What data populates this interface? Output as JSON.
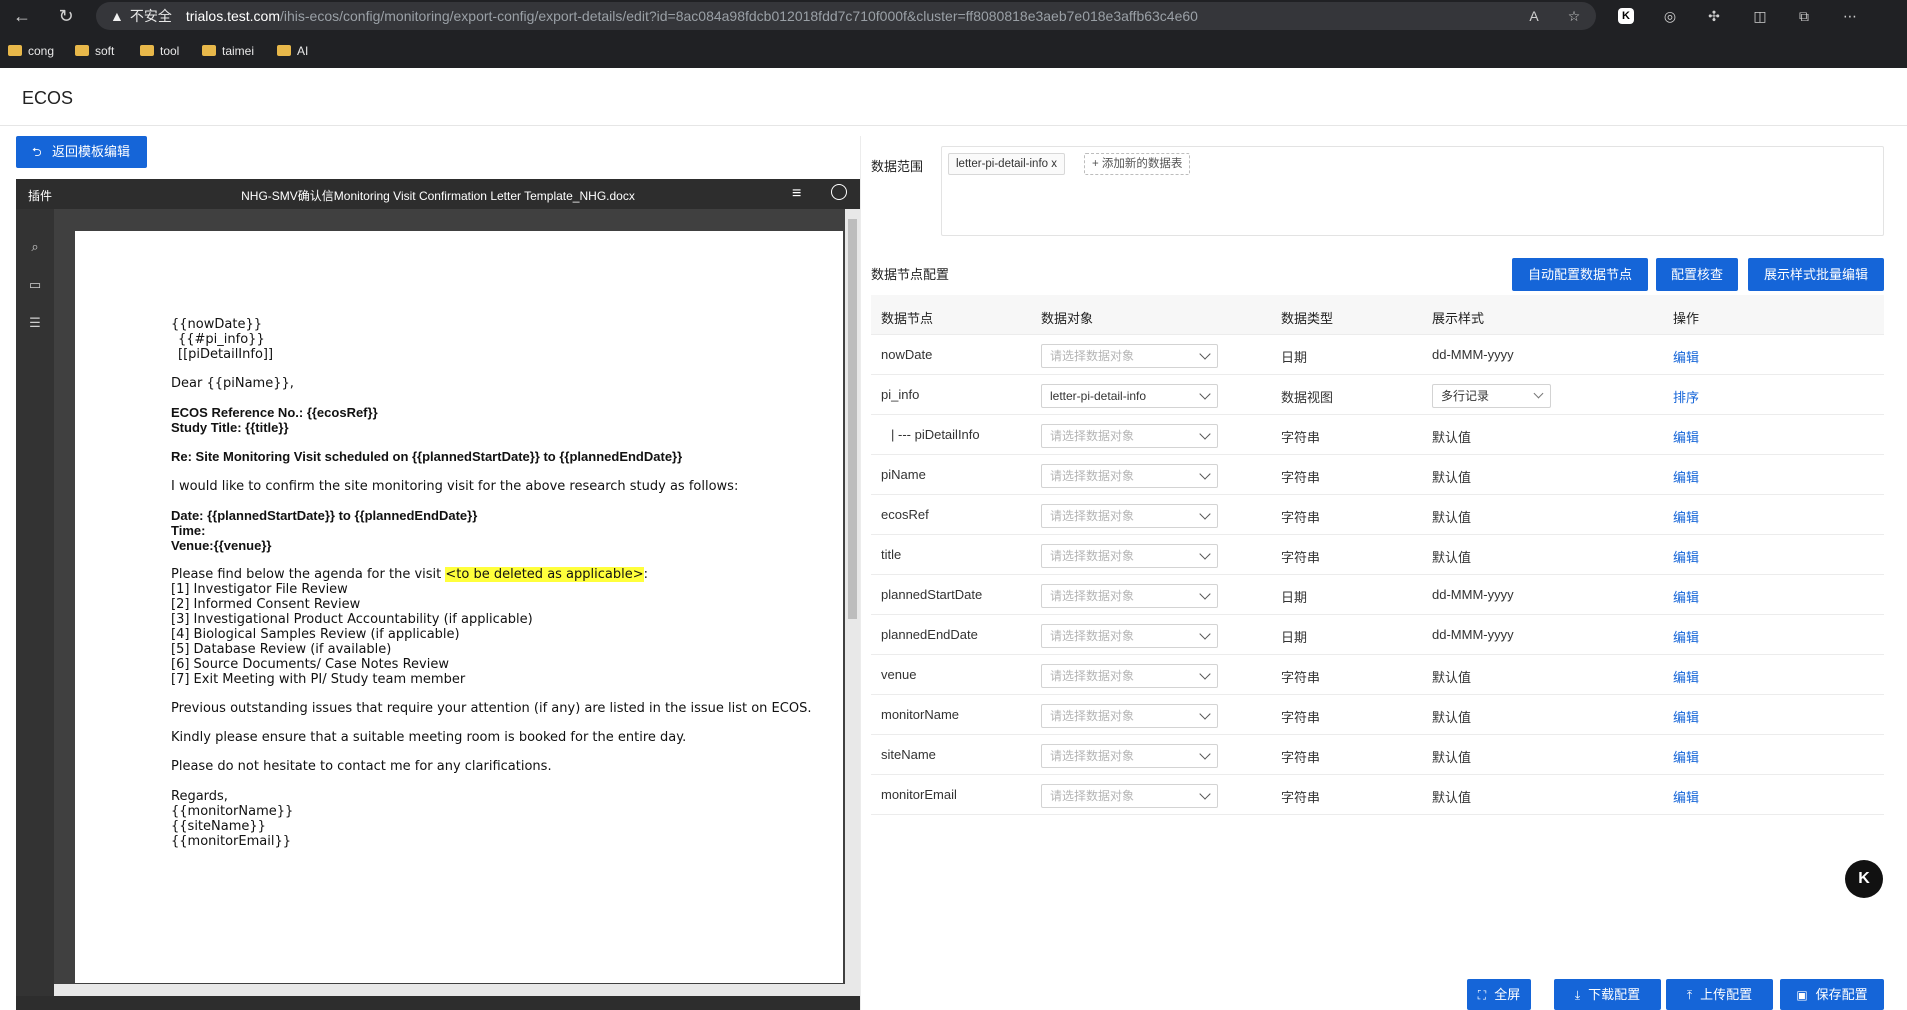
{
  "browser": {
    "security_warning": "不安全",
    "url_host": "trialos.test.com",
    "url_path": "/ihis-ecos/config/monitoring/export-config/export-details/edit?id=8ac084a98fdcb012018fdd7c710f000f&cluster=ff8080818e3aeb7e018e3affb63c4e60",
    "bookmarks": [
      "cong",
      "soft",
      "tool",
      "taimei",
      "AI"
    ]
  },
  "app": {
    "title": "ECOS"
  },
  "left": {
    "back_label": "返回模板编辑",
    "doc_toolbar": {
      "plugin_label": "插件",
      "file_name": "NHG-SMV确认信Monitoring Visit Confirmation Letter Template_NHG.docx"
    },
    "doc_lines": [
      "{{nowDate}}",
      "{{#pi_info}}",
      "[[piDetailInfo]]",
      "Dear {{piName}},",
      "ECOS Reference No.: {{ecosRef}}",
      "Study Title: {{title}}",
      "Re: Site Monitoring Visit scheduled on {{plannedStartDate}} to {{plannedEndDate}}",
      "I would like to confirm the site monitoring visit for the above research study as follows:",
      "Date: {{plannedStartDate}} to {{plannedEndDate}}",
      "Time:",
      "Venue:{{venue}}",
      "Please find below the agenda for the visit ",
      "<to be deleted as applicable>",
      ":",
      "[1] Investigator File Review",
      "[2] Informed Consent Review",
      "[3] Investigational Product Accountability (if applicable)",
      "[4] Biological Samples Review (if applicable)",
      "[5] Database Review (if available)",
      "[6] Source Documents/ Case Notes Review",
      "[7] Exit Meeting with PI/ Study team member",
      "Previous outstanding issues that require your attention (if any) are listed in the issue list on ECOS.",
      "Kindly please ensure that a suitable meeting room is booked for the entire day.",
      "Please do not hesitate to contact me for any clarifications.",
      "Regards,",
      "{{monitorName}}",
      "{{siteName}}",
      "{{monitorEmail}}"
    ]
  },
  "right": {
    "scope_label": "数据范围",
    "scope_tag": "letter-pi-detail-info",
    "scope_tag_close": "x",
    "add_table_label": "添加新的数据表",
    "node_config_label": "数据节点配置",
    "buttons": {
      "auto_config": "自动配置数据节点",
      "check_config": "配置核查",
      "batch_edit": "展示样式批量编辑"
    },
    "columns": [
      "数据节点",
      "数据对象",
      "数据类型",
      "展示样式",
      "操作"
    ],
    "select_placeholder": "请选择数据对象",
    "rows": [
      {
        "node": "nowDate",
        "object": "",
        "type": "日期",
        "style": "dd-MMM-yyyy",
        "action": "编辑"
      },
      {
        "node": "pi_info",
        "object": "letter-pi-detail-info",
        "type": "数据视图",
        "style": "多行记录",
        "action": "排序"
      },
      {
        "node": "| --- piDetailInfo",
        "object": "",
        "type": "字符串",
        "style": "默认值",
        "action": "编辑"
      },
      {
        "node": "piName",
        "object": "",
        "type": "字符串",
        "style": "默认值",
        "action": "编辑"
      },
      {
        "node": "ecosRef",
        "object": "",
        "type": "字符串",
        "style": "默认值",
        "action": "编辑"
      },
      {
        "node": "title",
        "object": "",
        "type": "字符串",
        "style": "默认值",
        "action": "编辑"
      },
      {
        "node": "plannedStartDate",
        "object": "",
        "type": "日期",
        "style": "dd-MMM-yyyy",
        "action": "编辑"
      },
      {
        "node": "plannedEndDate",
        "object": "",
        "type": "日期",
        "style": "dd-MMM-yyyy",
        "action": "编辑"
      },
      {
        "node": "venue",
        "object": "",
        "type": "字符串",
        "style": "默认值",
        "action": "编辑"
      },
      {
        "node": "monitorName",
        "object": "",
        "type": "字符串",
        "style": "默认值",
        "action": "编辑"
      },
      {
        "node": "siteName",
        "object": "",
        "type": "字符串",
        "style": "默认值",
        "action": "编辑"
      },
      {
        "node": "monitorEmail",
        "object": "",
        "type": "字符串",
        "style": "默认值",
        "action": "编辑"
      }
    ],
    "float_badge": "K",
    "bottom_buttons": {
      "fullscreen": "全屏",
      "download": "下载配置",
      "upload": "上传配置",
      "save": "保存配置"
    }
  },
  "colors": {
    "primary": "#1565d8",
    "highlight": "#ffff3c",
    "chrome": "#202124"
  }
}
